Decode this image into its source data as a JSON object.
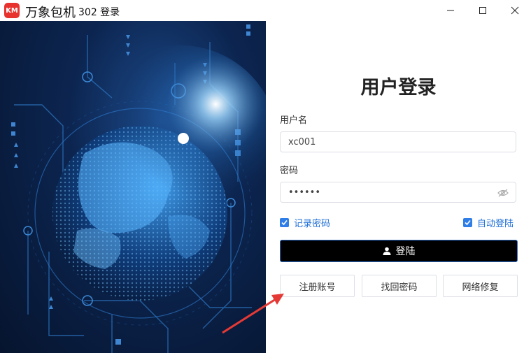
{
  "titlebar": {
    "logo_text": "KM",
    "app_name": "万象包机",
    "subtitle": "302 登录"
  },
  "form": {
    "title": "用户登录",
    "username_label": "用户名",
    "username_value": "xc001",
    "password_label": "密码",
    "password_value": "••••••",
    "remember_label": "记录密码",
    "auto_login_label": "自动登陆",
    "login_button": "登陆",
    "register_button": "注册账号",
    "recover_button": "找回密码",
    "repair_button": "网络修复"
  },
  "colors": {
    "accent": "#2f7ee8",
    "brand": "#e8322d",
    "login_bg": "#000000",
    "annotation_arrow": "#e53935"
  },
  "icons": {
    "logo": "app-logo-icon",
    "minimize": "minimize-icon",
    "maximize": "maximize-icon",
    "close": "close-icon",
    "eye": "eye-slash-icon",
    "user": "user-icon",
    "check": "check-icon"
  }
}
